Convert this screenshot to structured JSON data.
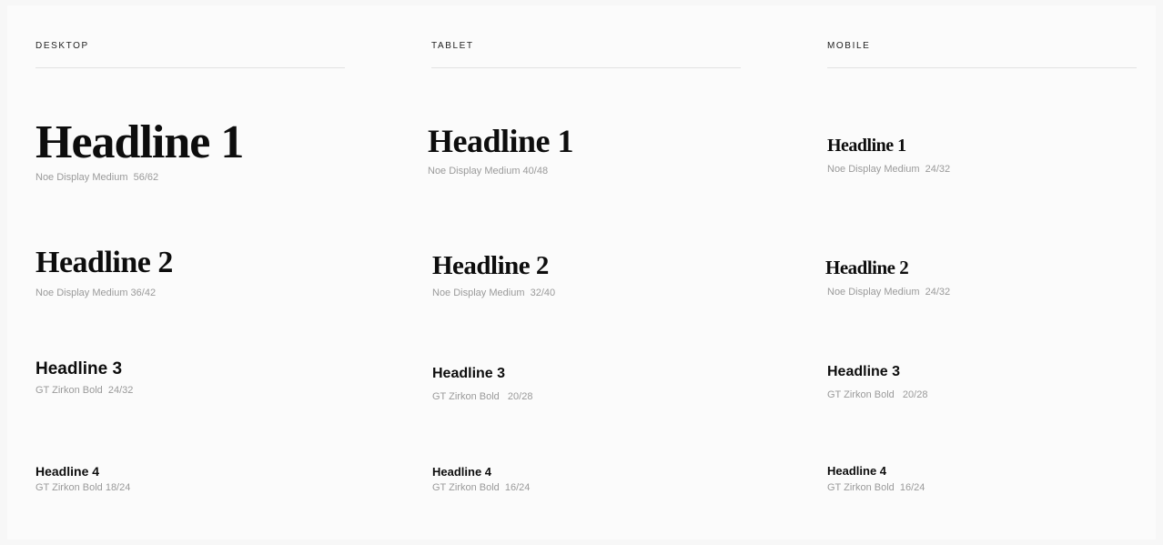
{
  "columns": {
    "desktop": {
      "title": "DESKTOP",
      "h1": {
        "name": "Headline 1",
        "meta": "Noe Display Medium  56/62"
      },
      "h2": {
        "name": "Headline 2",
        "meta": "Noe Display Medium 36/42"
      },
      "h3": {
        "name": "Headline 3",
        "meta": "GT Zirkon Bold  24/32"
      },
      "h4": {
        "name": "Headline 4",
        "meta": "GT Zirkon Bold 18/24"
      }
    },
    "tablet": {
      "title": "TABLET",
      "h1": {
        "name": "Headline 1",
        "meta": "Noe Display Medium 40/48"
      },
      "h2": {
        "name": "Headline 2",
        "meta": "Noe Display Medium  32/40"
      },
      "h3": {
        "name": "Headline 3",
        "meta": "GT Zirkon Bold   20/28"
      },
      "h4": {
        "name": "Headline 4",
        "meta": "GT Zirkon Bold  16/24"
      }
    },
    "mobile": {
      "title": "MOBILE",
      "h1": {
        "name": "Headline 1",
        "meta": "Noe Display Medium  24/32"
      },
      "h2": {
        "name": "Headline 2",
        "meta": "Noe Display Medium  24/32"
      },
      "h3": {
        "name": "Headline 3",
        "meta": "GT Zirkon Bold   20/28"
      },
      "h4": {
        "name": "Headline 4",
        "meta": "GT Zirkon Bold  16/24"
      }
    }
  }
}
